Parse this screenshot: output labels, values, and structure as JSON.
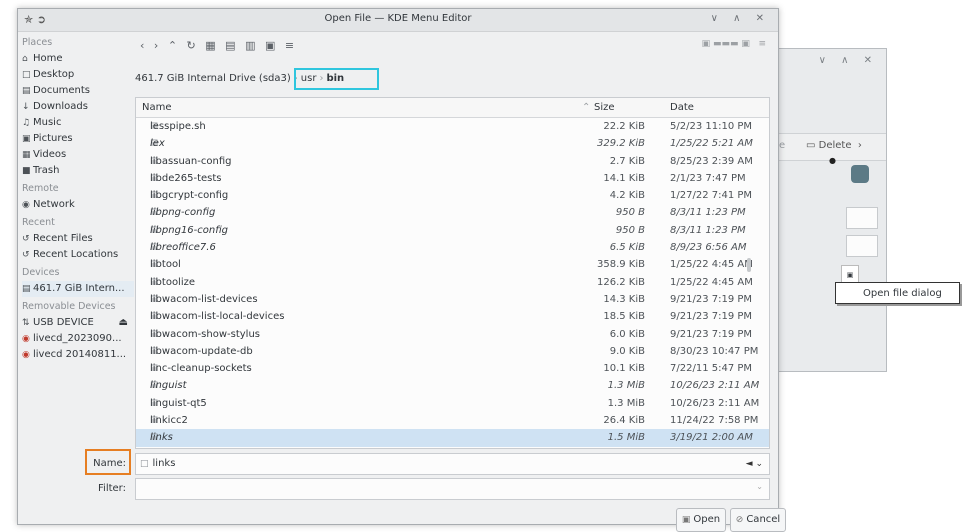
{
  "background_window": {
    "controls": "∨ ∧ ✕",
    "edit_label": "ate",
    "delete_label": "Delete",
    "next_label": "›",
    "tooltip": "Open file dialog"
  },
  "dialog": {
    "title": "Open File — KDE Menu Editor",
    "window_controls": "∨ ∧ ✕"
  },
  "places": {
    "header": "Places",
    "items": [
      "Home",
      "Desktop",
      "Documents",
      "Downloads",
      "Music",
      "Pictures",
      "Videos",
      "Trash"
    ],
    "remote_header": "Remote",
    "remote_items": [
      "Network"
    ],
    "recent_header": "Recent",
    "recent_items": [
      "Recent Files",
      "Recent Locations"
    ],
    "devices_header": "Devices",
    "devices_items": [
      "461.7 GiB Intern..."
    ],
    "removable_header": "Removable Devices",
    "removable_items": [
      "USB DEVICE",
      "livecd_2023090...",
      "livecd 20140811..."
    ]
  },
  "breadcrumb": {
    "drive": "461.7 GiB Internal Drive (sda3)",
    "segments": [
      "usr",
      "bin"
    ]
  },
  "columns": {
    "name": "Name",
    "size": "Size",
    "date": "Date"
  },
  "files": [
    {
      "name": "lesspipe.sh",
      "size": "22.2 KiB",
      "date": "5/2/23 11:10 PM",
      "italic": false
    },
    {
      "name": "lex",
      "size": "329.2 KiB",
      "date": "1/25/22 5:21 AM",
      "italic": true
    },
    {
      "name": "libassuan-config",
      "size": "2.7 KiB",
      "date": "8/25/23 2:39 AM",
      "italic": false
    },
    {
      "name": "libde265-tests",
      "size": "14.1 KiB",
      "date": "2/1/23 7:47 PM",
      "italic": false
    },
    {
      "name": "libgcrypt-config",
      "size": "4.2 KiB",
      "date": "1/27/22 7:41 PM",
      "italic": false
    },
    {
      "name": "libpng-config",
      "size": "950 B",
      "date": "8/3/11 1:23 PM",
      "italic": true
    },
    {
      "name": "libpng16-config",
      "size": "950 B",
      "date": "8/3/11 1:23 PM",
      "italic": true
    },
    {
      "name": "libreoffice7.6",
      "size": "6.5 KiB",
      "date": "8/9/23 6:56 AM",
      "italic": true
    },
    {
      "name": "libtool",
      "size": "358.9 KiB",
      "date": "1/25/22 4:45 AM",
      "italic": false
    },
    {
      "name": "libtoolize",
      "size": "126.2 KiB",
      "date": "1/25/22 4:45 AM",
      "italic": false
    },
    {
      "name": "libwacom-list-devices",
      "size": "14.3 KiB",
      "date": "9/21/23 7:19 PM",
      "italic": false
    },
    {
      "name": "libwacom-list-local-devices",
      "size": "18.5 KiB",
      "date": "9/21/23 7:19 PM",
      "italic": false
    },
    {
      "name": "libwacom-show-stylus",
      "size": "6.0 KiB",
      "date": "9/21/23 7:19 PM",
      "italic": false
    },
    {
      "name": "libwacom-update-db",
      "size": "9.0 KiB",
      "date": "8/30/23 10:47 PM",
      "italic": false
    },
    {
      "name": "linc-cleanup-sockets",
      "size": "10.1 KiB",
      "date": "7/22/11 5:47 PM",
      "italic": false
    },
    {
      "name": "linguist",
      "size": "1.3 MiB",
      "date": "10/26/23 2:11 AM",
      "italic": true
    },
    {
      "name": "linguist-qt5",
      "size": "1.3 MiB",
      "date": "10/26/23 2:11 AM",
      "italic": false
    },
    {
      "name": "linkicc2",
      "size": "26.4 KiB",
      "date": "11/24/22 7:58 PM",
      "italic": false
    },
    {
      "name": "links",
      "size": "1.5 MiB",
      "date": "3/19/21 2:00 AM",
      "italic": true,
      "selected": true
    }
  ],
  "form": {
    "name_label": "Name:",
    "name_value": "links",
    "filter_label": "Filter:",
    "filter_value": ""
  },
  "buttons": {
    "open": "Open",
    "cancel": "Cancel"
  },
  "colors": {
    "highlight_blue": "#2fc6de",
    "highlight_orange": "#e67e22",
    "selection": "#cfe2f3"
  }
}
